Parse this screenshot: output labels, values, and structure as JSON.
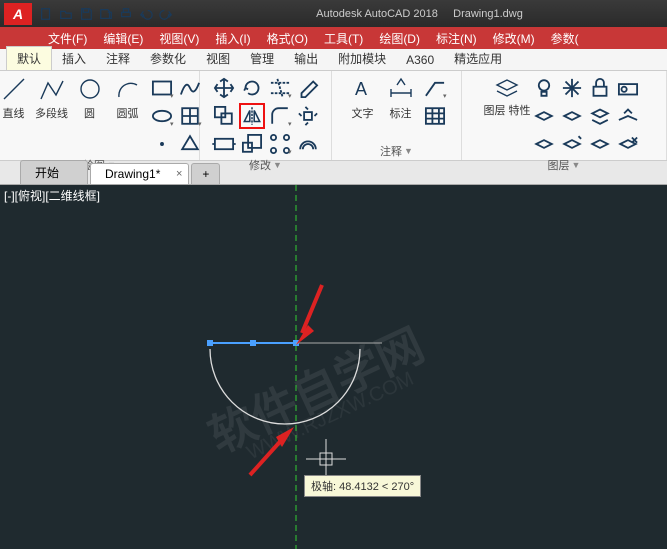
{
  "title": {
    "app": "Autodesk AutoCAD 2018",
    "doc": "Drawing1.dwg"
  },
  "menus": [
    "文件(F)",
    "编辑(E)",
    "视图(V)",
    "插入(I)",
    "格式(O)",
    "工具(T)",
    "绘图(D)",
    "标注(N)",
    "修改(M)",
    "参数("
  ],
  "ribbon_tabs": [
    "默认",
    "插入",
    "注释",
    "参数化",
    "视图",
    "管理",
    "输出",
    "附加模块",
    "A360",
    "精选应用"
  ],
  "panels": {
    "draw": {
      "label": "绘图",
      "big": [
        {
          "lbl": "直线"
        },
        {
          "lbl": "多段线"
        },
        {
          "lbl": "圆"
        },
        {
          "lbl": "圆弧"
        }
      ]
    },
    "modify": {
      "label": "修改"
    },
    "annot": {
      "label": "注释",
      "big": [
        {
          "lbl": "文字"
        },
        {
          "lbl": "标注"
        }
      ]
    },
    "layer": {
      "label": "图层",
      "big": [
        {
          "lbl": "图层\n特性"
        }
      ]
    }
  },
  "doctabs": [
    {
      "label": "开始",
      "active": false
    },
    {
      "label": "Drawing1*",
      "active": true
    }
  ],
  "canvas": {
    "view_label": "[-][俯视][二维线框]",
    "watermark": "软件自学网",
    "watermark_url": "WWW.RJZXW.COM",
    "tooltip": "极轴: 48.4132 < 270°"
  }
}
